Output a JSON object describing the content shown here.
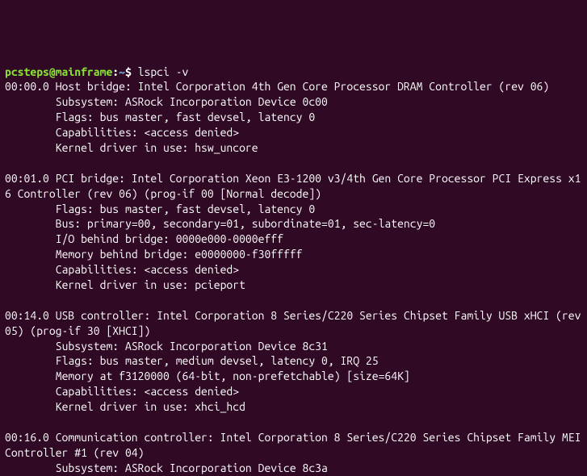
{
  "prompt": {
    "user_host": "pcsteps@mainframe",
    "sep": ":",
    "path": "~",
    "suffix": "$ ",
    "command": "lspci -v"
  },
  "devices": [
    {
      "header": "00:00.0 Host bridge: Intel Corporation 4th Gen Core Processor DRAM Controller (rev 06)",
      "lines": [
        "Subsystem: ASRock Incorporation Device 0c00",
        "Flags: bus master, fast devsel, latency 0",
        "Capabilities: <access denied>",
        "Kernel driver in use: hsw_uncore"
      ]
    },
    {
      "header": "00:01.0 PCI bridge: Intel Corporation Xeon E3-1200 v3/4th Gen Core Processor PCI Express x16 Controller (rev 06) (prog-if 00 [Normal decode])",
      "lines": [
        "Flags: bus master, fast devsel, latency 0",
        "Bus: primary=00, secondary=01, subordinate=01, sec-latency=0",
        "I/O behind bridge: 0000e000-0000efff",
        "Memory behind bridge: e0000000-f30fffff",
        "Capabilities: <access denied>",
        "Kernel driver in use: pcieport"
      ]
    },
    {
      "header": "00:14.0 USB controller: Intel Corporation 8 Series/C220 Series Chipset Family USB xHCI (rev 05) (prog-if 30 [XHCI])",
      "lines": [
        "Subsystem: ASRock Incorporation Device 8c31",
        "Flags: bus master, medium devsel, latency 0, IRQ 25",
        "Memory at f3120000 (64-bit, non-prefetchable) [size=64K]",
        "Capabilities: <access denied>",
        "Kernel driver in use: xhci_hcd"
      ]
    },
    {
      "header": "00:16.0 Communication controller: Intel Corporation 8 Series/C220 Series Chipset Family MEI Controller #1 (rev 04)",
      "lines": [
        "Subsystem: ASRock Incorporation Device 8c3a"
      ]
    }
  ]
}
